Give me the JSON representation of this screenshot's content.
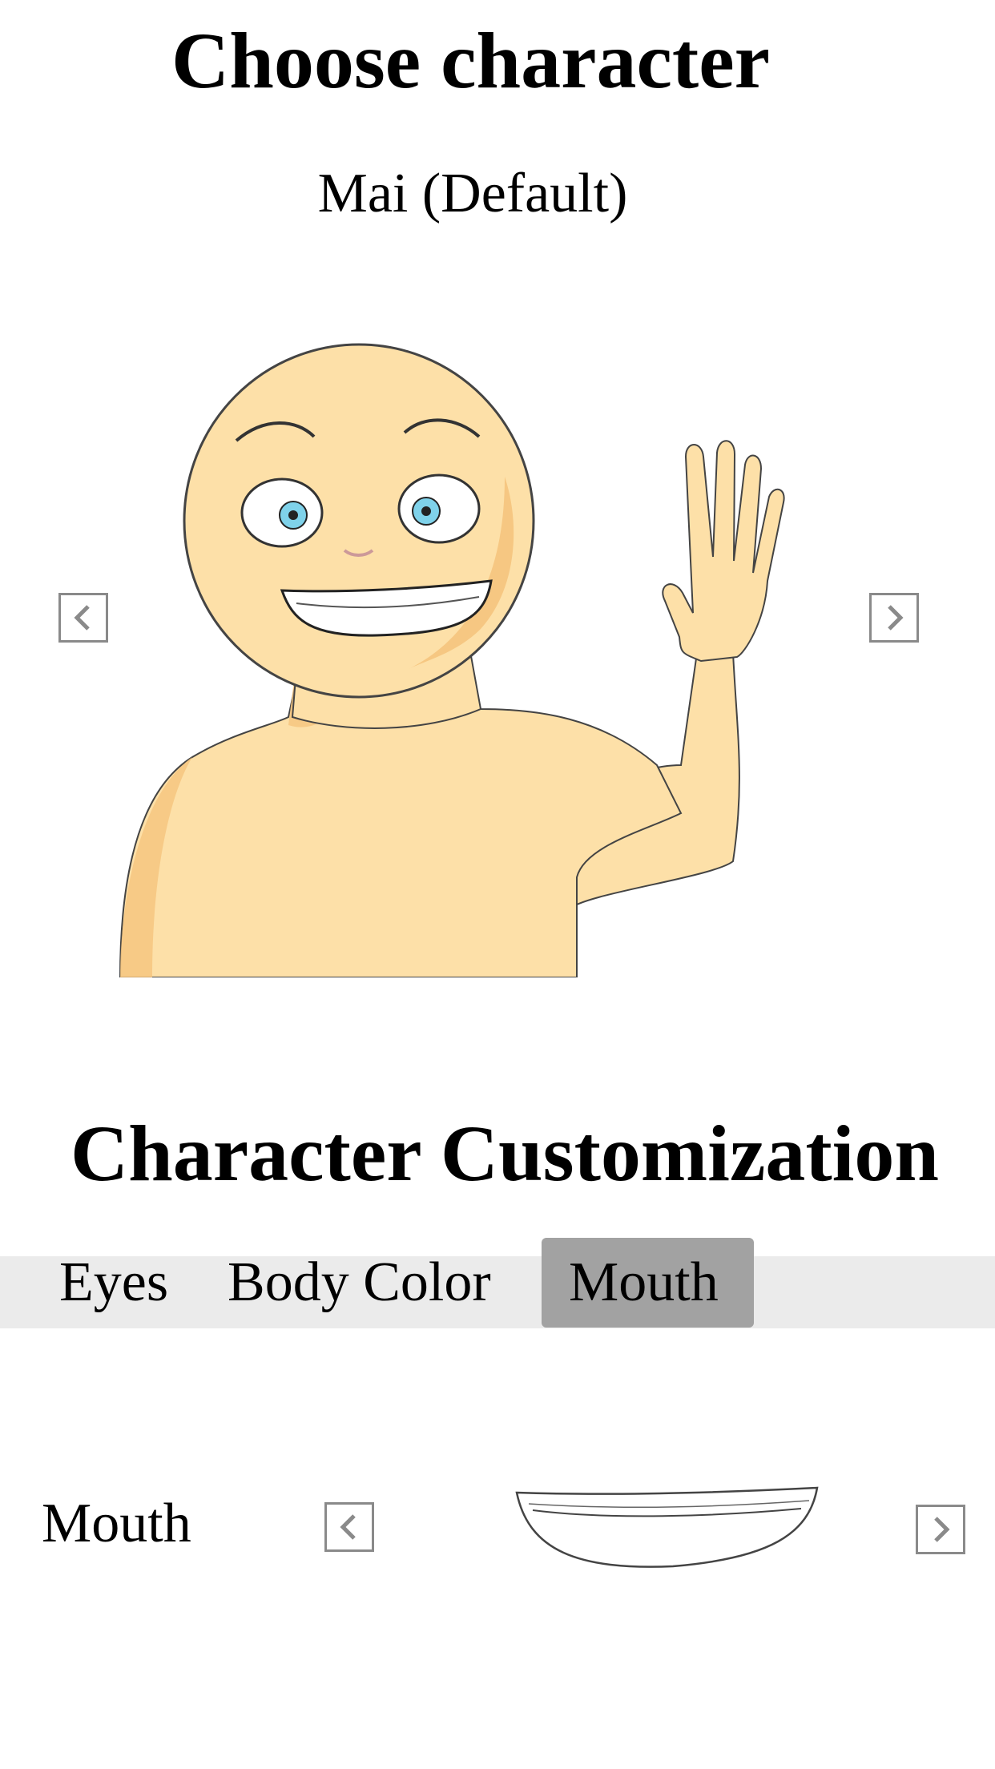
{
  "header": {
    "title": "Choose character"
  },
  "character": {
    "name": "Mai (Default)",
    "prev_icon": "chevron-left-icon",
    "next_icon": "chevron-right-icon"
  },
  "customization": {
    "title": "Character Customization",
    "tabs": [
      {
        "label": "Eyes",
        "active": false
      },
      {
        "label": "Body Color",
        "active": false
      },
      {
        "label": "Mouth",
        "active": true
      }
    ],
    "option": {
      "label": "Mouth",
      "prev_icon": "chevron-left-icon",
      "next_icon": "chevron-right-icon"
    }
  },
  "colors": {
    "skin": "#fde0a8",
    "skin_shade": "#f5c47d",
    "eye_iris": "#7fd2ea",
    "tab_bar": "#ebebeb",
    "tab_active": "#a2a2a2",
    "button_border": "#8a8a8a"
  }
}
